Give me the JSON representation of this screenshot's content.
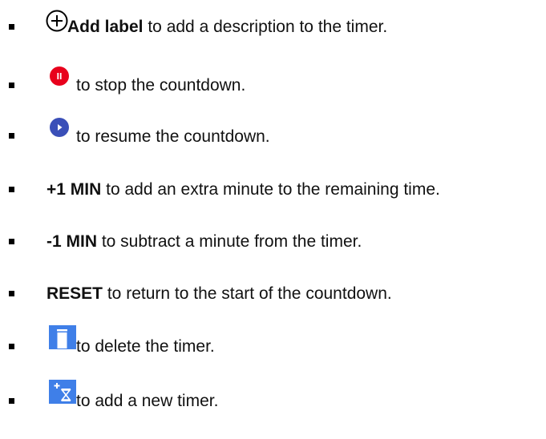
{
  "items": [
    {
      "icon": "add-circle-icon",
      "bold": "Add label",
      "text": " to add a description to the timer."
    },
    {
      "icon": "red-pause-icon",
      "bold": "",
      "text": "to stop the countdown."
    },
    {
      "icon": "blue-play-icon",
      "bold": "",
      "text": "to resume the countdown."
    },
    {
      "icon": "",
      "bold": "+1 MIN",
      "text": " to add an extra minute to the remaining time."
    },
    {
      "icon": "",
      "bold": "-1 MIN",
      "text": " to subtract a minute from the timer."
    },
    {
      "icon": "",
      "bold": "RESET",
      "text": " to return to the start of the countdown."
    },
    {
      "icon": "trash-icon",
      "bold": "",
      "text": "to delete the timer."
    },
    {
      "icon": "add-timer-icon",
      "bold": "",
      "text": "to add a new timer."
    }
  ],
  "colors": {
    "pause": "#e8001c",
    "play": "#3a4fb8",
    "tile": "#3f7fe8"
  }
}
